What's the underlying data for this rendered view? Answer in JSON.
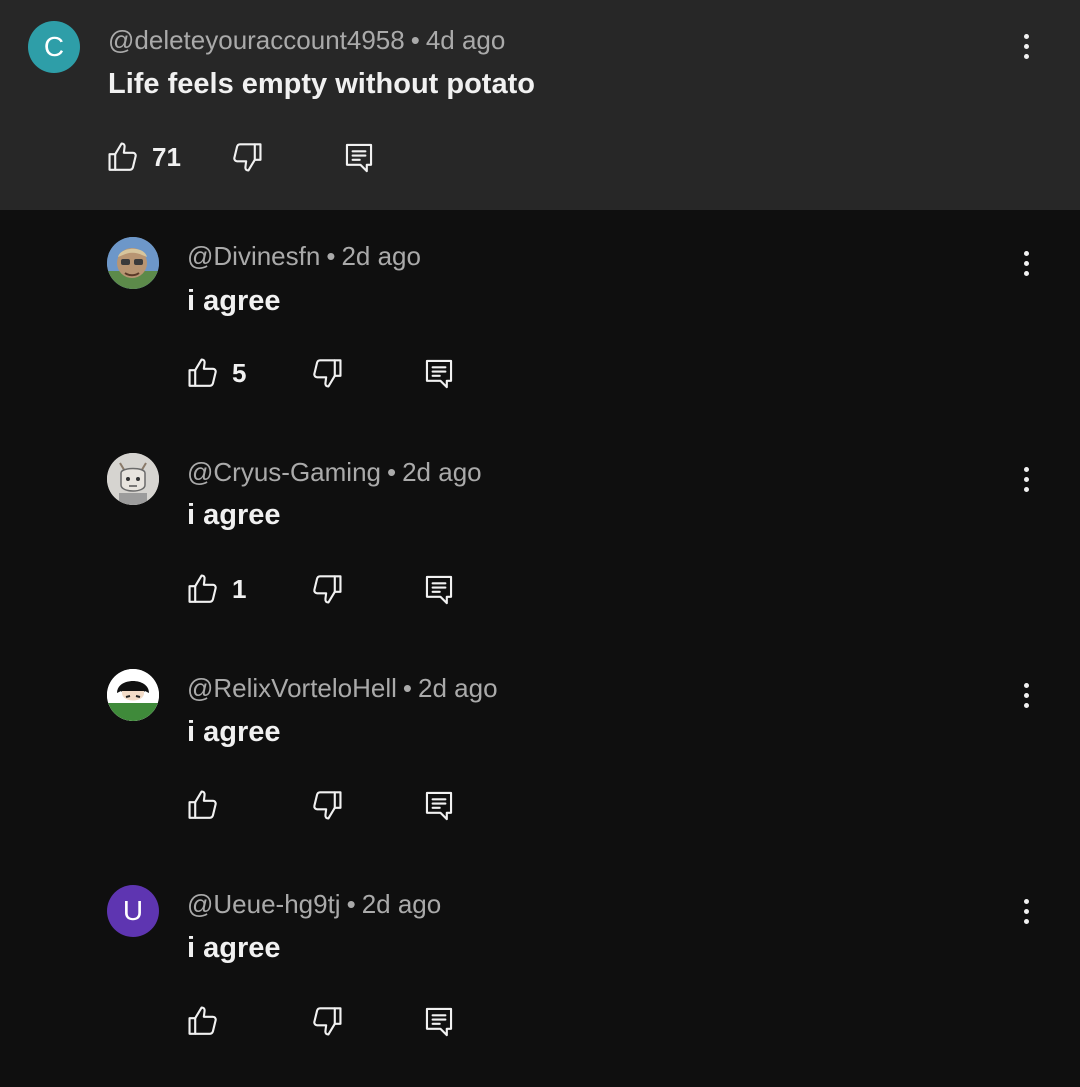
{
  "parent_comment": {
    "avatar_letter": "C",
    "avatar_color": "#2e9ea8",
    "handle": "@deleteyouraccount4958",
    "separator": "•",
    "time": "4d ago",
    "text": "Life feels empty without potato",
    "likes": "71"
  },
  "replies": [
    {
      "handle": "@Divinesfn",
      "separator": "•",
      "time": "2d ago",
      "text": "i agree",
      "likes": "5",
      "avatar_icon": "avatar-photo-icon"
    },
    {
      "handle": "@Cryus-Gaming",
      "separator": "•",
      "time": "2d ago",
      "text": "i agree",
      "likes": "1",
      "avatar_icon": "avatar-drawing-icon"
    },
    {
      "handle": "@RelixVorteloHell",
      "separator": "•",
      "time": "2d ago",
      "text": "i agree",
      "likes": "",
      "avatar_icon": "avatar-anime-icon"
    },
    {
      "handle": "@Ueue-hg9tj",
      "separator": "•",
      "time": "2d ago",
      "text": "i agree",
      "likes": "",
      "avatar_letter": "U",
      "avatar_color": "#5e35b1"
    }
  ],
  "colors": {
    "background": "#0f0f0f",
    "highlight": "#272727",
    "meta_text": "#aaaaaa",
    "primary_text": "#f1f1f1"
  }
}
